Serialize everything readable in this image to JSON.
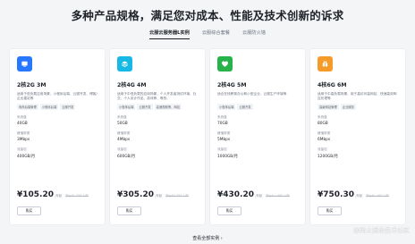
{
  "headline": "多种产品规格，满足您对成本、性能及技术创新的诉求",
  "tabs": [
    {
      "label": "云服云服务器L实例",
      "active": true
    },
    {
      "label": "云服综合套餐",
      "active": false
    },
    {
      "label": "云服防火墙",
      "active": false
    }
  ],
  "cards": [
    {
      "icon": "cloud-server-icon",
      "icon_color": "#2878ff",
      "name": "2核2G 3M",
      "desc": "适用于低负载应用场景，小程序后端、云服开发、博客/企业建站等",
      "tags": [
        "电商后端管理",
        "小程序后端",
        "云服开发"
      ],
      "disk_label": "系统盘",
      "disk_value": "40GB",
      "bw_label": "峰值带宽",
      "bw_value": "3Mbps",
      "traffic_label": "流量包",
      "traffic_value": "400GB/月",
      "price": "¥105.20",
      "unit": "/年起",
      "orig": "原价¥1 558.2/年",
      "buy": "购买"
    },
    {
      "icon": "cloud-server-icon",
      "icon_color": "#18b8e6",
      "name": "2核4G 4M",
      "desc": "适用于中低负载的应用场景，个人开发者测试环境、社交、个人设计作品、游戏等、等的、",
      "tags": [
        "小程序后端",
        "云服开发",
        "高速视频等、网站"
      ],
      "disk_label": "系统盘",
      "disk_value": "50GB",
      "bw_label": "峰值带宽",
      "bw_value": "4Mbps",
      "traffic_label": "流量包",
      "traffic_value": "600GB/月",
      "price": "¥305.20",
      "unit": "/年起",
      "orig": "原价¥4 755.2/年",
      "buy": "购买"
    },
    {
      "icon": "cloud-server-icon",
      "icon_color": "#27b24a",
      "name": "2核4G 5M",
      "desc": "适合在线教育办公和小型企业、云服生产环境等",
      "tags": [
        "小程序后端",
        "云服开发"
      ],
      "disk_label": "系统盘",
      "disk_value": "70GB",
      "bw_label": "峰值带宽",
      "bw_value": "5Mbps",
      "traffic_label": "流量包",
      "traffic_value": "1000GB/月",
      "price": "¥430.20",
      "unit": "/年起",
      "orig": "原价¥ 1 060.2/年",
      "buy": "购买"
    },
    {
      "icon": "cloud-server-icon",
      "icon_color": "#f59b2a",
      "name": "4核6G 6M",
      "desc": "适用于中高负载场景、用于高访问量网站、快速高效响应处理等",
      "tags": [
        "高级网站管理",
        "企业服务"
      ],
      "disk_label": "系统盘",
      "disk_value": "80GB",
      "bw_label": "峰值带宽",
      "bw_value": "6Mbps",
      "traffic_label": "流量包",
      "traffic_value": "1200GB/月",
      "price": "¥750.30",
      "unit": "/年起",
      "orig": "原价¥1 400.2/年",
      "buy": "购买"
    }
  ],
  "more": "查看全部实例 ›",
  "watermark": "@稀土掘金技术社区"
}
